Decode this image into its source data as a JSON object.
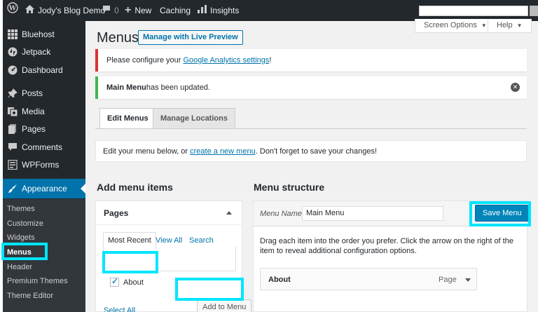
{
  "colors": {
    "adminbar": "#23282d",
    "accent": "#0073aa",
    "highlight": "#00e5ff",
    "error": "#dc3232",
    "success": "#46b450"
  },
  "adminbar": {
    "wp_logo": "wordpress-icon",
    "site_name": "Jody's Blog Demo",
    "comments_count": "0",
    "new_label": "New",
    "caching_label": "Caching",
    "insights_label": "Insights"
  },
  "sidebar": {
    "items": [
      {
        "label": "Bluehost",
        "icon": "grid-icon"
      },
      {
        "label": "Jetpack",
        "icon": "jetpack-icon"
      },
      {
        "label": "Dashboard",
        "icon": "dashboard-icon"
      },
      {
        "label": "Posts",
        "icon": "pin-icon"
      },
      {
        "label": "Media",
        "icon": "media-icon"
      },
      {
        "label": "Pages",
        "icon": "pages-icon"
      },
      {
        "label": "Comments",
        "icon": "comment-icon"
      },
      {
        "label": "WPForms",
        "icon": "forms-icon"
      },
      {
        "label": "Appearance",
        "icon": "brush-icon"
      }
    ],
    "submenu": [
      "Themes",
      "Customize",
      "Widgets",
      "Menus",
      "Header",
      "Premium Themes",
      "Theme Editor"
    ]
  },
  "header": {
    "title": "Menus",
    "preview_button": "Manage with Live Preview",
    "screen_options": "Screen Options",
    "help": "Help"
  },
  "notices": {
    "error_prefix": "Please configure your ",
    "error_link": "Google Analytics settings",
    "error_suffix": "!",
    "success_bold": "Main Menu",
    "success_text": " has been updated."
  },
  "tabs": {
    "edit": "Edit Menus",
    "locations": "Manage Locations"
  },
  "info": {
    "prefix": "Edit your menu below, or ",
    "link": "create a new menu",
    "suffix": ". Don't forget to save your changes!"
  },
  "add_items": {
    "heading": "Add menu items",
    "panel_title": "Pages",
    "subtabs": [
      "Most Recent",
      "View All",
      "Search"
    ],
    "page_item": "About",
    "page_checked": true,
    "select_all": "Select All",
    "add_button": "Add to Menu"
  },
  "structure": {
    "heading": "Menu structure",
    "menu_name_label": "Menu Name",
    "menu_name_value": "Main Menu",
    "save_button": "Save Menu",
    "description": "Drag each item into the order you prefer. Click the arrow on the right of the item to reveal additional configuration options.",
    "item_title": "About",
    "item_type": "Page"
  }
}
